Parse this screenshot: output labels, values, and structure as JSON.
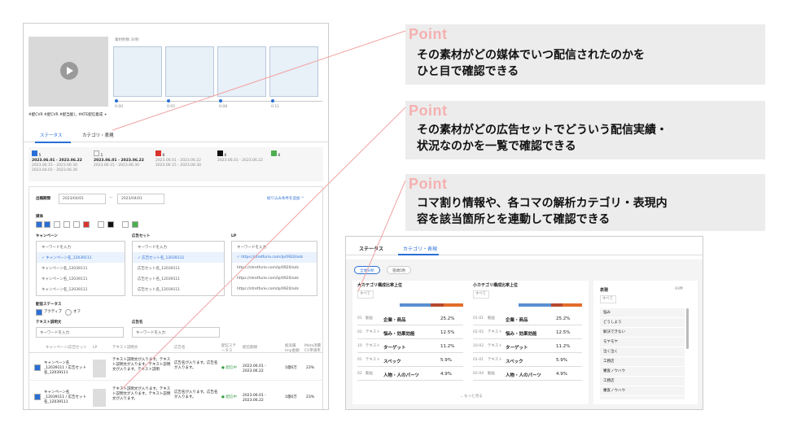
{
  "callouts": [
    {
      "point": "Point",
      "line1": "その素材がどの媒体でいつ配信されたのかを",
      "line2": "ひと目で確認できる"
    },
    {
      "point": "Point",
      "line1": "その素材がどの広告セットでどういう配信実績・",
      "line2": "状況なのかを一覧で確認できる"
    },
    {
      "point": "Point",
      "line1": "コマ割り情報や、各コマの解析カテゴリ・表現内",
      "line2": "容を該当箇所とを連動して確認できる"
    }
  ],
  "left": {
    "duration_label": "素材秒数 30秒",
    "timeline_times": [
      "0:00",
      "0:05",
      "0:08",
      "0:11"
    ],
    "tags": "#配CVR  #配CVR  #配当能し  #KTE配信着成  +",
    "tabs": [
      "ステータス",
      "カテゴリ・表現"
    ],
    "cards": [
      {
        "count": "5",
        "range1": "2023.06.01 - 2023.06.22",
        "range2": "2023.06.15 - 2023.06.30",
        "range3": "2023.04.01 - 2023.06.30",
        "color": "#2a6fd6"
      },
      {
        "count": "1",
        "range1": "2023.06.01 - 2023.06.22",
        "range2": "2023.06.15 - 2023.06.30",
        "range3": "",
        "color": "#ffffff"
      },
      {
        "count": "6",
        "range1": "2023.06.01 - 2023.06.22",
        "range2": "2023.06.15 - 2023.06.30",
        "range3": "",
        "color": "#d9342b"
      },
      {
        "count": "6",
        "range1": "2023.06.01 - 2023.06.22",
        "range2": "",
        "range3": "",
        "color": "#111111"
      },
      {
        "count": "6",
        "range1": "",
        "range2": "",
        "range3": "",
        "color": "#4caf50"
      }
    ],
    "filter": {
      "period_label": "出稿期間",
      "date_from": "2023/04/01",
      "date_to": "2023/04/01",
      "search_link": "絞り込み条件を追加  ^",
      "media_label": "媒体",
      "campaign_label": "キャンペーン",
      "adset_label": "広告セット",
      "lp_label": "LP",
      "keyword_placeholder": "キーワードを入力",
      "campaign_items": [
        "✓ キャンペーン名_12039111",
        "キャンペーン名_12039111",
        "キャンペーン名_12039111",
        "キャンペーン名_12039111"
      ],
      "adset_items": [
        "✓ 広告セット名_12039111",
        "広告セット名_12039111",
        "広告セット名_12039111",
        "広告セット名_12039111"
      ],
      "lp_items": [
        "✓ https://stretfurie.com/lp/0920/ads",
        "https://stretfurie.com/lp/0920/ads",
        "https://stretfurie.com/lp/0920/ads",
        "https://stretfurie.com/lp/0920/ads"
      ],
      "status_label": "配信ステータス",
      "status_active": "アクティブ",
      "status_off": "オフ",
      "text_label": "テキスト説明文",
      "adname_label": "広告名",
      "text_placeholder": "キーワードを入力",
      "table_headers": [
        "キャンペーン/広告セット",
        "LP",
        "テキスト説明文",
        "広告名",
        "配信ステータス",
        "配信期間",
        "総実績 Imp金額",
        "Meta消費 CV単価率"
      ],
      "rows": [
        {
          "campaign": "キャンペーン名_12039111 / 広告セット名_12039111",
          "text": "テキスト説明文が入ります。テキスト説明文が入ります。テキスト説明文が入ります。テキスト説明",
          "adname": "広告名が入ります。広告名が入ります。",
          "status": "● 配信中",
          "period": "2023.06.01 - 2023.06.22",
          "imp": "1億6万",
          "cv": "23%"
        },
        {
          "campaign": "キャンペーン名_12039111 / 広告セット名_12039111",
          "text": "テキスト説明文が入ります。テキスト説明文が入ります。テキスト説明文が入ります。",
          "adname": "広告名が入ります。広告名が入ります。",
          "status": "● 配信中",
          "period": "2023.06.01 - 2023.06.22",
          "imp": "1億6万",
          "cv": "23%"
        }
      ]
    }
  },
  "right": {
    "tabs": [
      "ステータス",
      "カテゴリ・表現"
    ],
    "pills": [
      "全体分析",
      "冒頭5秒"
    ],
    "big_title": "大カテゴリ構成比率上位",
    "small_title": "小カテゴリ構成比率上位",
    "expr_title": "表現",
    "expr_count": "93件",
    "all": "すべて",
    "big_rows": [
      {
        "time": "01",
        "type": "動画",
        "name": "企業・商品",
        "pct": "25.2%"
      },
      {
        "time": "02",
        "type": "テキスト",
        "name": "悩み・効果効能",
        "pct": "12.5%"
      },
      {
        "time": "10",
        "type": "テキスト",
        "name": "ターゲット",
        "pct": "11.2%"
      },
      {
        "time": "01",
        "type": "テキスト",
        "name": "スペック",
        "pct": "5.9%"
      },
      {
        "time": "02",
        "type": "動画",
        "name": "人物・人のパーツ",
        "pct": "4.9%"
      }
    ],
    "small_rows": [
      {
        "time": "01-01",
        "type": "動画",
        "name": "企業・商品",
        "pct": "25.2%"
      },
      {
        "time": "02-02",
        "type": "テキスト",
        "name": "悩み・効果効能",
        "pct": "12.5%"
      },
      {
        "time": "10-02",
        "type": "テキスト",
        "name": "ターゲット",
        "pct": "11.2%"
      },
      {
        "time": "01-01",
        "type": "テキスト",
        "name": "スペック",
        "pct": "5.9%"
      },
      {
        "time": "02-04",
        "type": "動画",
        "name": "人物・人のパーツ",
        "pct": "4.9%"
      }
    ],
    "expr_items": [
      "悩み",
      "どうしよう",
      "解決できない",
      "モヤモヤ",
      "泣く泣く",
      "工務店",
      "審査ノウハウ",
      "工務店",
      "審査ノウハウ"
    ],
    "more": "⌄ もっと見る"
  }
}
